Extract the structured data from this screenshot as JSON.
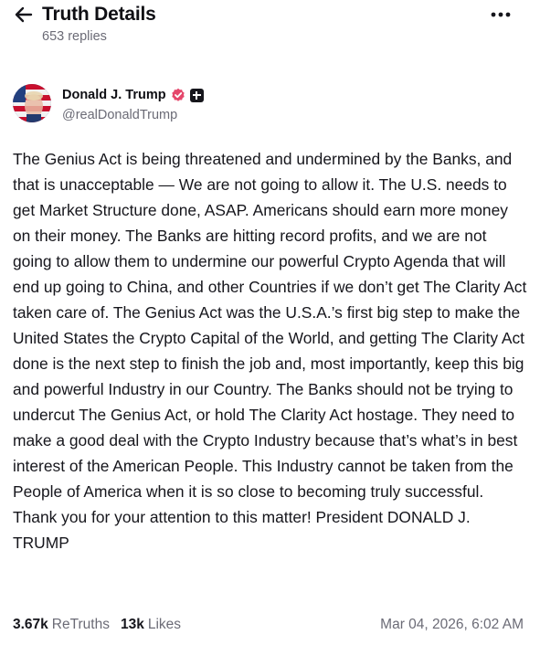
{
  "header": {
    "title": "Truth Details",
    "replies": "653 replies",
    "back_icon": "arrow-left-icon",
    "more_icon": "more-horizontal-icon"
  },
  "post": {
    "author": {
      "name": "Donald J. Trump",
      "handle": "@realDonaldTrump",
      "verified_color": "#e5476b"
    },
    "text": "The Genius Act is being threatened and undermined by the Banks, and that is unacceptable — We are not going to allow it. The U.S. needs to get Market Structure done, ASAP. Americans should earn more money on their money. The Banks are hitting record profits, and we are not going to allow them to undermine our powerful Crypto Agenda that will end up going to China, and other Countries if we don’t get The Clarity Act taken care of. The Genius Act was the U.S.A.’s first big step to make the United States the Crypto Capital of the World, and getting The Clarity Act done is the next step to finish the job and, most importantly, keep this big and powerful Industry in our Country. The Banks should not be trying to undercut The Genius Act, or hold The Clarity Act hostage. They need to make a good deal with the Crypto Industry because that’s what’s in best interest of the American People. This Industry cannot be taken from the People of America when it is so close to becoming truly successful. Thank you for your attention to this matter! President DONALD J. TRUMP",
    "stats": {
      "retruths_count": "3.67k",
      "retruths_label": "ReTruths",
      "likes_count": "13k",
      "likes_label": "Likes"
    },
    "timestamp": "Mar 04, 2026, 6:02 AM"
  }
}
